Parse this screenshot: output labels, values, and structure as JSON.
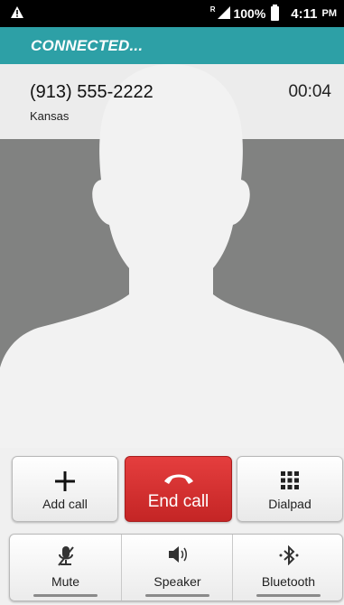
{
  "status_bar": {
    "signal_flag": "R",
    "battery": "100%",
    "time": "4:11",
    "ampm": "PM",
    "alert_icon": "warning-icon"
  },
  "call": {
    "status": "CONNECTED...",
    "number": "(913) 555-2222",
    "location": "Kansas",
    "duration": "00:04"
  },
  "actions": {
    "add_call": "Add call",
    "end_call": "End call",
    "dialpad": "Dialpad"
  },
  "toggles": {
    "mute": "Mute",
    "speaker": "Speaker",
    "bluetooth": "Bluetooth"
  },
  "colors": {
    "banner": "#2da0a6",
    "end_call": "#d32f2f",
    "photo_bg": "#818281"
  }
}
